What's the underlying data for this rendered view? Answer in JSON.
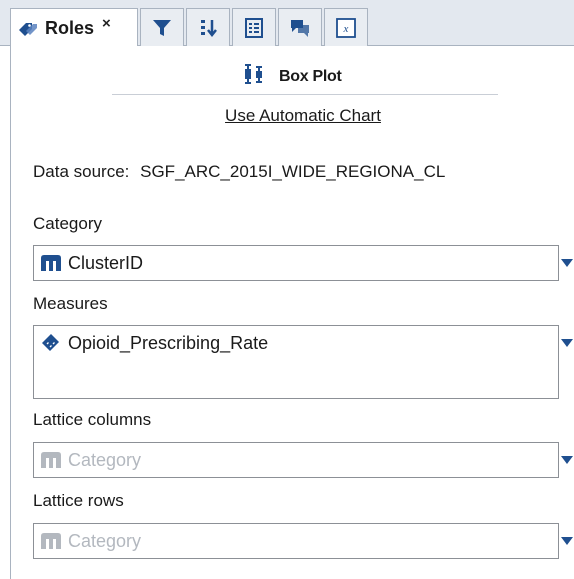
{
  "tabs": {
    "roles": {
      "label": "Roles",
      "close": "×"
    }
  },
  "chart_type": {
    "label": "Box Plot"
  },
  "auto_chart": {
    "label": "Use Automatic Chart"
  },
  "data_source": {
    "label": "Data source:",
    "value": "SGF_ARC_2015I_WIDE_REGIONA_CL"
  },
  "roles": {
    "category": {
      "label": "Category",
      "value": "ClusterID"
    },
    "measures": {
      "label": "Measures",
      "value": "Opioid_Prescribing_Rate"
    },
    "lattice_columns": {
      "label": "Lattice columns",
      "placeholder": "Category"
    },
    "lattice_rows": {
      "label": "Lattice rows",
      "placeholder": "Category"
    }
  },
  "colors": {
    "accent": "#1f4f8f",
    "placeholder": "#b3b8bf",
    "tab_bg": "#e3e8ef"
  }
}
